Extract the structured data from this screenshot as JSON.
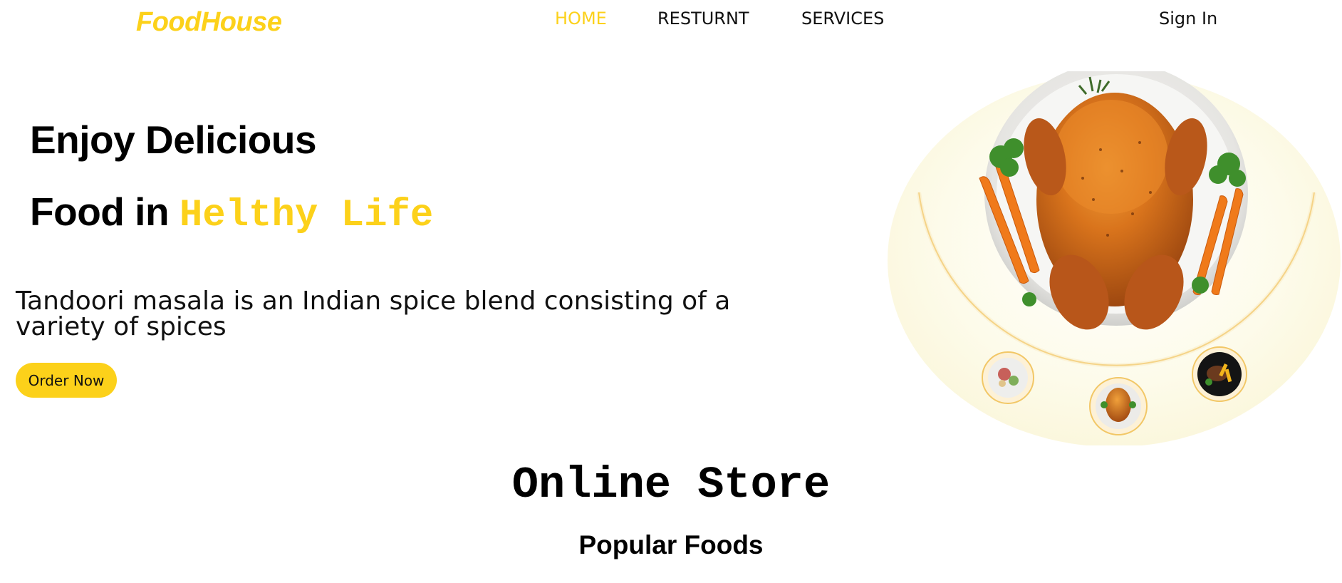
{
  "brand": {
    "logo": "FoodHouse"
  },
  "nav": {
    "items": [
      {
        "label": "HOME",
        "active": true
      },
      {
        "label": "RESTURNT",
        "active": false
      },
      {
        "label": "SERVICES",
        "active": false
      }
    ],
    "sign_in": "Sign In"
  },
  "hero": {
    "line1": "Enjoy Delicious",
    "line2_prefix": "Food in",
    "line2_accent": "Helthy Life",
    "description": "Tandoori masala is an Indian spice blend consisting of a variety of spices",
    "cta": "Order Now"
  },
  "section": {
    "title": "Online Store",
    "subtitle": "Popular Foods"
  },
  "colors": {
    "accent": "#fcd11a",
    "text": "#111111",
    "hero_bg": "#fdfbea"
  },
  "icons": [
    "roast-chicken-plate-image",
    "salad-dish-thumbnail",
    "chicken-dish-thumbnail",
    "steak-dish-thumbnail"
  ]
}
